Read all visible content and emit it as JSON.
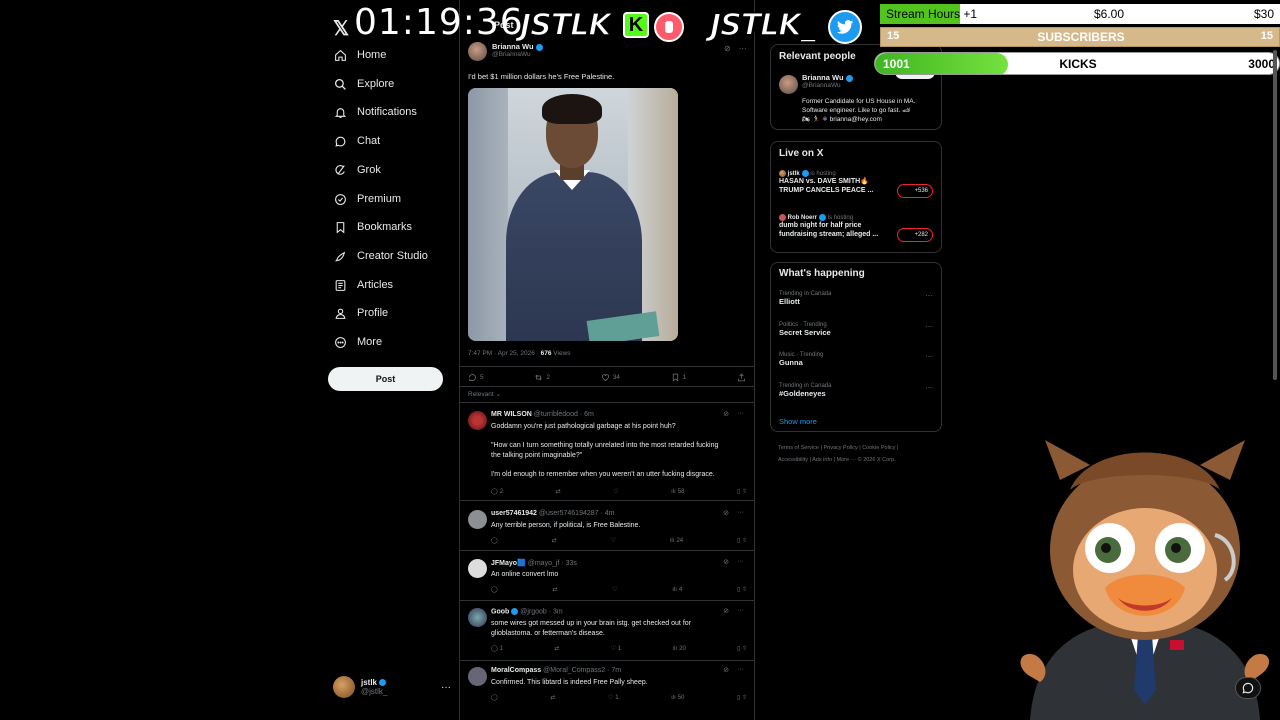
{
  "nav": {
    "logo": "𝕏",
    "items": [
      {
        "label": "Home",
        "icon": "home-icon"
      },
      {
        "label": "Explore",
        "icon": "search-icon"
      },
      {
        "label": "Notifications",
        "icon": "bell-icon"
      },
      {
        "label": "Chat",
        "icon": "chat-icon"
      },
      {
        "label": "Grok",
        "icon": "grok-icon"
      },
      {
        "label": "Premium",
        "icon": "premium-icon"
      },
      {
        "label": "Bookmarks",
        "icon": "bookmark-icon"
      },
      {
        "label": "Creator Studio",
        "icon": "rocket-icon"
      },
      {
        "label": "Articles",
        "icon": "articles-icon"
      },
      {
        "label": "Profile",
        "icon": "person-icon"
      },
      {
        "label": "More",
        "icon": "more-circle-icon"
      }
    ],
    "post_button": "Post",
    "account": {
      "name": "jstlk",
      "handle": "@jstlk_",
      "menu": "···"
    }
  },
  "post": {
    "header_label": "Post",
    "author": "Brianna Wu",
    "handle": "@BriannaWu",
    "text": "I'd bet $1 million dollars he's Free Palestine.",
    "timestamp": "7:47 PM · Apr 25, 2026 · ",
    "views_count": "676",
    "views_label": " Views",
    "actions": {
      "replies": "5",
      "reposts": "2",
      "likes": "34",
      "bookmarks": "1"
    },
    "sort_label": "Relevant ⌄"
  },
  "replies": [
    {
      "name": "MR WILSON",
      "meta": "@turribledood · 6m",
      "lines": [
        "Goddamn you're just pathological garbage at his point huh?",
        "",
        "\"How can I turn something totally unrelated into the most retarded fucking",
        "the talking point imaginable?\"",
        "",
        "I'm old enough to remember when you weren't an utter fucking disgrace."
      ],
      "stats": {
        "replies": "2",
        "reposts": "",
        "likes": "",
        "views": "58"
      }
    },
    {
      "name": "user57461942",
      "meta": "@user5746194287 · 4m",
      "lines": [
        "Any terrible person, if political, is Free Balestine."
      ],
      "stats": {
        "replies": "",
        "reposts": "",
        "likes": "",
        "views": "24"
      }
    },
    {
      "name": "JFMayo🟦",
      "meta": "@mayo_jf · 33s",
      "lines": [
        "An online convert lmo"
      ],
      "stats": {
        "replies": "",
        "reposts": "",
        "likes": "",
        "views": "4"
      }
    },
    {
      "name": "Goob",
      "meta": "@jrgoob · 3m",
      "lines": [
        "some wires got messed up in your brain istg. get checked out for",
        "glioblastoma. or fetterman's disease."
      ],
      "stats": {
        "replies": "1",
        "reposts": "",
        "likes": "1",
        "views": "20"
      }
    },
    {
      "name": "MoralCompass",
      "meta": "@Moral_Compass2 · 7m",
      "lines": [
        "Confirmed. This libtard is indeed Free Pally sheep."
      ],
      "stats": {
        "replies": "",
        "reposts": "",
        "likes": "1",
        "views": "50"
      }
    }
  ],
  "relevant_people": {
    "title": "Relevant people",
    "name": "Brianna Wu",
    "handle": "@BriannaWu",
    "follow": "Follow",
    "bio": [
      "Former Candidate for US House in MA.",
      "Software engineer. Like to go fast. 🏎",
      "🏍 🏃 ⚛ brianna@hey.com"
    ]
  },
  "live": {
    "title": "Live on X",
    "items": [
      {
        "host": "jstlk",
        "status": " is hosting",
        "title": [
          "HASAN vs. DAVE SMITH🔥",
          "TRUMP CANCELS PEACE ..."
        ],
        "count": "+536"
      },
      {
        "host": "Rob Noerr",
        "status": " is hosting",
        "title": [
          "dumb night for half price",
          "fundraising stream; alleged ..."
        ],
        "count": "+282"
      }
    ]
  },
  "happening": {
    "title": "What's happening",
    "trends": [
      {
        "category": "Trending in Canada",
        "name": "Elliott"
      },
      {
        "category": "Politics · Trending",
        "name": "Secret Service"
      },
      {
        "category": "Music · Trending",
        "name": "Gunna"
      },
      {
        "category": "Trending in Canada",
        "name": "#Goldeneyes"
      }
    ],
    "show_more": "Show more"
  },
  "footer": {
    "links": [
      "Terms of Service",
      "Privacy Policy",
      "Cookie Policy",
      "Accessibility",
      "Ads info",
      "More ···",
      "© 2026 X Corp."
    ]
  },
  "overlay": {
    "clock": "01:19:36",
    "brand_left": "JSTLK",
    "kick_badge": "K",
    "brand_right": "JSTLK_",
    "stream_hours": {
      "label": "Stream Hours",
      "increment": "+1",
      "mid_amount": "$6.00",
      "goal": "$30",
      "progress": 0.2
    },
    "subscribers": {
      "left": "15",
      "label": "SUBSCRIBERS",
      "right": "15"
    },
    "kicks": {
      "current": "1001",
      "label": "KICKS",
      "goal": "3000",
      "progress": 0.33
    }
  },
  "colors": {
    "accent": "#1d9bf0",
    "kick_green": "#53fc18",
    "live_red": "#f4212e",
    "sub_tan": "#d6b98a"
  }
}
